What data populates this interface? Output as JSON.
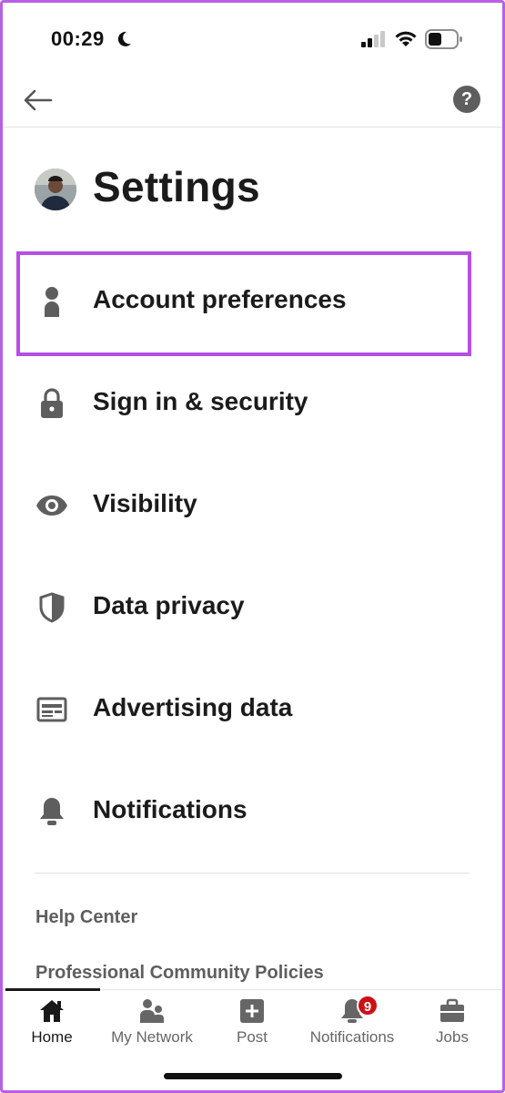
{
  "status_bar": {
    "time": "00:29",
    "icons": [
      "moon-icon",
      "signal-icon",
      "wifi-icon",
      "battery-icon"
    ]
  },
  "top_nav": {
    "back_icon": "arrow-left-icon",
    "help_label": "?"
  },
  "header": {
    "title": "Settings"
  },
  "menu": [
    {
      "label": "Account preferences",
      "icon": "person-icon",
      "highlighted": true
    },
    {
      "label": "Sign in & security",
      "icon": "lock-icon"
    },
    {
      "label": "Visibility",
      "icon": "eye-icon"
    },
    {
      "label": "Data privacy",
      "icon": "shield-icon"
    },
    {
      "label": "Advertising data",
      "icon": "ad-card-icon"
    },
    {
      "label": "Notifications",
      "icon": "bell-icon"
    }
  ],
  "footer_links": [
    {
      "label": "Help Center"
    },
    {
      "label": "Professional Community Policies"
    }
  ],
  "tabs": [
    {
      "label": "Home",
      "icon": "home-icon",
      "active": true
    },
    {
      "label": "My Network",
      "icon": "people-icon"
    },
    {
      "label": "Post",
      "icon": "plus-square-icon"
    },
    {
      "label": "Notifications",
      "icon": "bell-icon",
      "badge": "9"
    },
    {
      "label": "Jobs",
      "icon": "briefcase-icon"
    }
  ],
  "colors": {
    "highlight": "#b450e4",
    "text": "#1b1b1b",
    "icon_gray": "#5e5e5e",
    "badge": "#cc1016"
  }
}
